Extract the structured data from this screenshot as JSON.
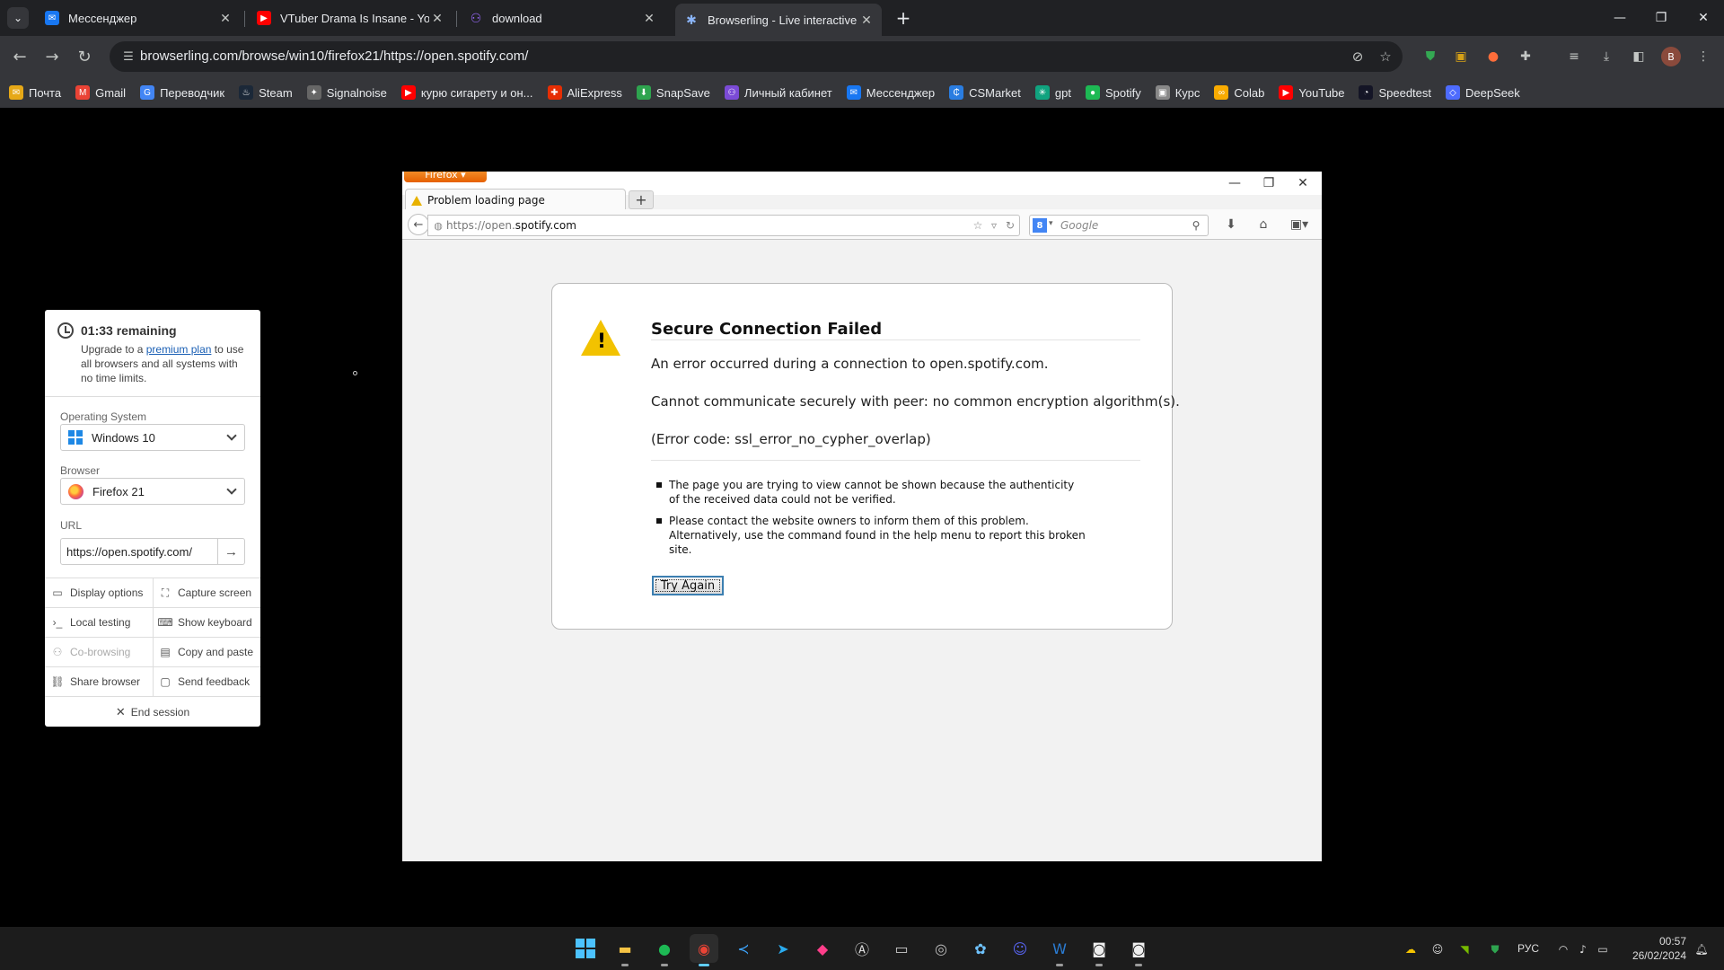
{
  "chrome": {
    "tabs": [
      {
        "title": "Мессенджер",
        "favicon": "messenger-icon",
        "color": "#1877f2"
      },
      {
        "title": "VTuber Drama Is Insane - YouTu",
        "favicon": "youtube-icon",
        "color": "#ff0000"
      },
      {
        "title": "download",
        "favicon": "gradient-link-icon",
        "color": "#7b4bd6"
      },
      {
        "title": "Browserling - Live interactive cr",
        "favicon": "browserling-icon",
        "color": "#4a90d9",
        "active": true
      }
    ],
    "address": "browserling.com/browse/win10/firefox21/https://open.spotify.com/",
    "profile_initial": "B",
    "bookmarks": [
      {
        "label": "Почта",
        "icon": "mail-icon",
        "color": "#e6a817"
      },
      {
        "label": "Gmail",
        "icon": "gmail-icon",
        "color": "#ea4335"
      },
      {
        "label": "Переводчик",
        "icon": "translate-icon",
        "color": "#4285f4"
      },
      {
        "label": "Steam",
        "icon": "steam-icon",
        "color": "#1b2838"
      },
      {
        "label": "Signalnoise",
        "icon": "signalnoise-icon",
        "color": "#666666"
      },
      {
        "label": "курю сигарету и он...",
        "icon": "youtube-icon",
        "color": "#ff0000"
      },
      {
        "label": "AliExpress",
        "icon": "aliexpress-icon",
        "color": "#e62e04"
      },
      {
        "label": "SnapSave",
        "icon": "snapsave-icon",
        "color": "#2ea44f"
      },
      {
        "label": "Личный кабинет",
        "icon": "cabinet-icon",
        "color": "#7b4bd6"
      },
      {
        "label": "Мессенджер",
        "icon": "messenger-icon",
        "color": "#1877f2"
      },
      {
        "label": "CSMarket",
        "icon": "csmarket-icon",
        "color": "#2a7de1"
      },
      {
        "label": "gpt",
        "icon": "openai-icon",
        "color": "#10a37f"
      },
      {
        "label": "Spotify",
        "icon": "spotify-icon",
        "color": "#1db954"
      },
      {
        "label": "Курс",
        "icon": "course-icon",
        "color": "#888888"
      },
      {
        "label": "Colab",
        "icon": "colab-icon",
        "color": "#f9ab00"
      },
      {
        "label": "YouTube",
        "icon": "youtube-icon",
        "color": "#ff0000"
      },
      {
        "label": "Speedtest",
        "icon": "speedtest-icon",
        "color": "#141526"
      },
      {
        "label": "DeepSeek",
        "icon": "deepseek-icon",
        "color": "#4d6bfe"
      }
    ]
  },
  "panel": {
    "timer": "01:33 remaining",
    "upgrade_pre": "Upgrade to a ",
    "upgrade_link": "premium plan",
    "upgrade_post": " to use all browsers and all systems with no time limits.",
    "os_label": "Operating System",
    "os_value": "Windows 10",
    "browser_label": "Browser",
    "browser_value": "Firefox 21",
    "url_label": "URL",
    "url_value": "https://open.spotify.com/",
    "buttons": {
      "display": "Display options",
      "capture": "Capture screen",
      "local": "Local testing",
      "keyboard": "Show keyboard",
      "cobrowse": "Co-browsing",
      "copy": "Copy and paste",
      "share": "Share browser",
      "feedback": "Send feedback",
      "end": "End session"
    }
  },
  "firefox": {
    "menu_label": "Firefox",
    "tab_title": "Problem loading page",
    "url_prefix": "https://open.",
    "url_domain": "spotify.com",
    "search_placeholder": "Google",
    "error": {
      "title": "Secure Connection Failed",
      "line1": "An error occurred during a connection to open.spotify.com.",
      "line2": "Cannot communicate securely with peer: no common encryption algorithm(s).",
      "line3": "(Error code: ssl_error_no_cypher_overlap)",
      "bullet1": "The page you are trying to view cannot be shown because the authenticity of the received data could not be verified.",
      "bullet2": "Please contact the website owners to inform them of this problem. Alternatively, use the command found in the help menu to report this broken site.",
      "button": "Try Again"
    }
  },
  "taskbar": {
    "lang": "РУС",
    "time": "00:57",
    "date": "26/02/2024"
  }
}
